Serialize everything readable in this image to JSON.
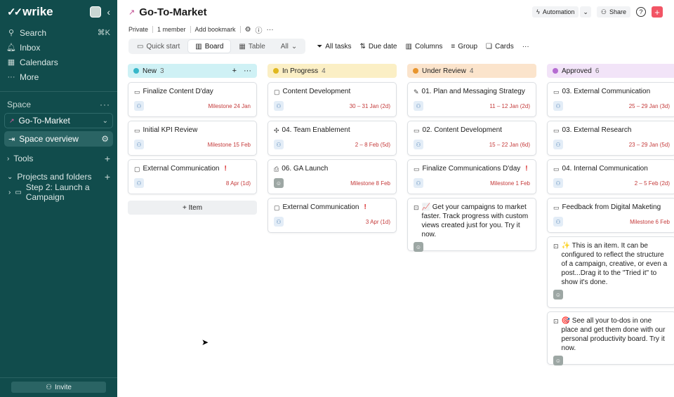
{
  "app": {
    "brand": "wrike",
    "collapse_icon": "chevron-left-icon"
  },
  "sidebar": {
    "nav": [
      {
        "label": "Search",
        "icon": "search-icon",
        "shortcut": "⌘K"
      },
      {
        "label": "Inbox",
        "icon": "bell-icon",
        "shortcut": ""
      },
      {
        "label": "Calendars",
        "icon": "calendar-icon",
        "shortcut": ""
      },
      {
        "label": "More",
        "icon": "dots-icon",
        "shortcut": ""
      }
    ],
    "space_label": "Space",
    "space_name": "Go-To-Market",
    "space_overview": "Space overview",
    "tools": "Tools",
    "projects": "Projects and folders",
    "project_item": "Step 2: Launch a Campaign",
    "invite": "Invite"
  },
  "header": {
    "title": "Go-To-Market",
    "automation": "Automation",
    "share": "Share",
    "help": "?",
    "add": "+"
  },
  "subhead": {
    "privacy": "Private",
    "members": "1 member",
    "bookmark": "Add bookmark"
  },
  "views": [
    {
      "label": "Quick start",
      "active": false
    },
    {
      "label": "Board",
      "active": true
    },
    {
      "label": "Table",
      "active": false
    },
    {
      "label": "All",
      "active": false
    }
  ],
  "tools": [
    "All tasks",
    "Due date",
    "Columns",
    "Group",
    "Cards"
  ],
  "colors": {
    "new": "#cff1f5",
    "in_progress": "#fbefc5",
    "under_review": "#fbe4cc",
    "approved": "#f2e4f8",
    "new_dot": "#37b7c9",
    "in_progress_dot": "#e0b81e",
    "under_review_dot": "#e8952d",
    "approved_dot": "#b56bd1"
  },
  "columns": [
    {
      "name": "New",
      "count": "3",
      "cards": [
        {
          "title": "Finalize Content D'day",
          "date": "Milestone 24 Jan",
          "alert": false
        },
        {
          "title": "Initial KPI Review",
          "date": "Milestone 15 Feb",
          "alert": false
        },
        {
          "title": "External Communication",
          "date": "8 Apr (1d)",
          "alert": true
        }
      ],
      "add_item": "+ Item"
    },
    {
      "name": "In Progress",
      "count": "4",
      "cards": [
        {
          "title": "Content Development",
          "date": "30 – 31 Jan (2d)",
          "alert": false
        },
        {
          "title": "04. Team Enablement",
          "date": "2 – 8 Feb (5d)",
          "alert": false
        },
        {
          "title": "06. GA Launch",
          "date": "Milestone 8 Feb",
          "alert": false
        },
        {
          "title": "External Communication",
          "date": "3 Apr (1d)",
          "alert": true
        }
      ]
    },
    {
      "name": "Under Review",
      "count": "4",
      "cards": [
        {
          "title": "01. Plan and Messaging Strategy",
          "date": "11 – 12 Jan (2d)",
          "alert": false
        },
        {
          "title": "02. Content Development",
          "date": "15 – 22 Jan (6d)",
          "alert": false
        },
        {
          "title": "Finalize Communications D'day",
          "date": "Milestone 1 Feb",
          "alert": true
        },
        {
          "title": "📈 Get your campaigns to market faster. Track progress with custom views created just for you. Try it now.",
          "date": "",
          "alert": false
        }
      ]
    },
    {
      "name": "Approved",
      "count": "6",
      "cards": [
        {
          "title": "03. External Communication",
          "date": "25 – 29 Jan (3d)",
          "alert": false
        },
        {
          "title": "03. External Research",
          "date": "23 – 29 Jan (5d)",
          "alert": false
        },
        {
          "title": "04. Internal Communication",
          "date": "2 – 5 Feb (2d)",
          "alert": false
        },
        {
          "title": "Feedback from Digital Maketing",
          "date": "Milestone 6 Feb",
          "alert": false
        },
        {
          "title": "✨ This is an item. It can be configured to reflect the structure of a campaign, creative, or even a post...Drag it to the \"Tried it\" to show it's done.",
          "date": "",
          "alert": false
        },
        {
          "title": "🎯 See all your to-dos in one place and get them done with our personal productivity board. Try it now.",
          "date": "",
          "alert": false
        }
      ]
    }
  ]
}
